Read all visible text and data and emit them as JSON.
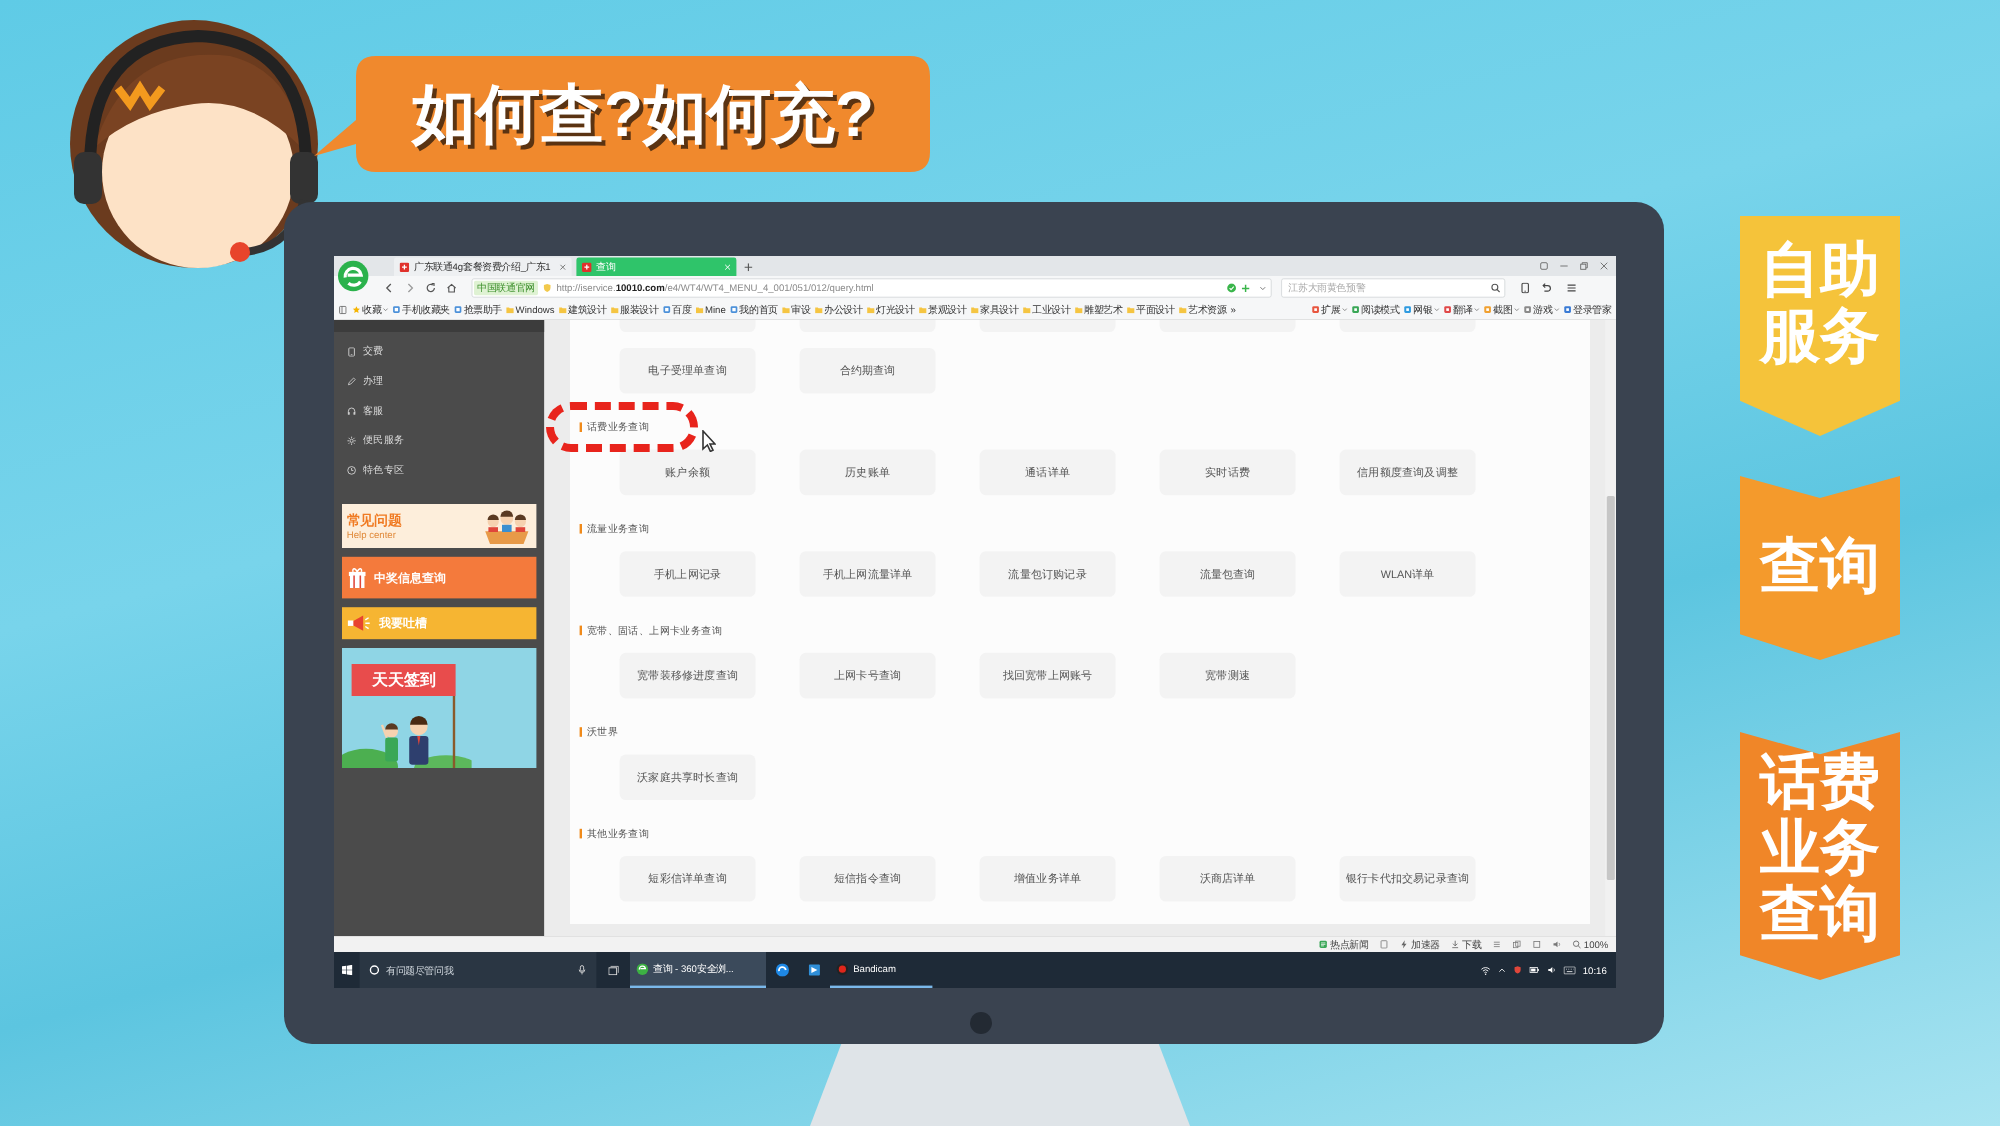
{
  "speech_bubble": {
    "text": "如何查?如何充?"
  },
  "ribbons": [
    {
      "text": "自助服务",
      "color": "#f5c33a"
    },
    {
      "text": "查询",
      "color": "#f49a2c"
    },
    {
      "text": "话费业务查询",
      "color": "#f08628"
    }
  ],
  "browser": {
    "tabs": [
      {
        "title": "广东联通4g套餐资费介绍_广东1",
        "selected": false
      },
      {
        "title": "查询",
        "selected": true
      }
    ],
    "address": {
      "site_badge": "中国联通官网",
      "url": "http://iservice.**10010.com**/e4/WT4/WT4_MENU_4_001/051/012/query.html"
    },
    "search": {
      "placeholder": "江苏大雨黄色预警"
    },
    "bookmarks": [
      {
        "kind": "menu",
        "label": "收藏"
      },
      {
        "kind": "site",
        "label": "手机收藏夹"
      },
      {
        "kind": "site",
        "label": "抢票助手"
      },
      {
        "kind": "folder",
        "label": "Windows"
      },
      {
        "kind": "folder",
        "label": "建筑设计"
      },
      {
        "kind": "folder",
        "label": "服装设计"
      },
      {
        "kind": "site",
        "label": "百度"
      },
      {
        "kind": "folder",
        "label": "Mine"
      },
      {
        "kind": "site",
        "label": "我的首页"
      },
      {
        "kind": "folder",
        "label": "审设"
      },
      {
        "kind": "folder",
        "label": "办公设计"
      },
      {
        "kind": "folder",
        "label": "灯光设计"
      },
      {
        "kind": "folder",
        "label": "景观设计"
      },
      {
        "kind": "folder",
        "label": "家具设计"
      },
      {
        "kind": "folder",
        "label": "工业设计"
      },
      {
        "kind": "folder",
        "label": "雕塑艺术"
      },
      {
        "kind": "folder",
        "label": "平面设计"
      },
      {
        "kind": "folder",
        "label": "艺术资源"
      },
      {
        "kind": "more",
        "label": "»"
      }
    ],
    "extensions": [
      {
        "label": "扩展",
        "dropdown": true
      },
      {
        "label": "阅读模式",
        "dropdown": false
      },
      {
        "label": "网银",
        "dropdown": true
      },
      {
        "label": "翻译",
        "dropdown": true
      },
      {
        "label": "截图",
        "dropdown": true
      },
      {
        "label": "游戏",
        "dropdown": true
      },
      {
        "label": "登录管家",
        "dropdown": false
      }
    ]
  },
  "sidebar": {
    "items": [
      {
        "label": "交费"
      },
      {
        "label": "办理"
      },
      {
        "label": "客服"
      },
      {
        "label": "便民服务"
      },
      {
        "label": "特色专区"
      }
    ],
    "banners": [
      {
        "kind": "help",
        "title": "常见问题",
        "subtitle": "Help center"
      },
      {
        "kind": "prize",
        "title": "中奖信息查询"
      },
      {
        "kind": "feedback",
        "title": "我要吐槽"
      },
      {
        "kind": "checkin",
        "title": "天天签到"
      }
    ]
  },
  "content": {
    "sections": [
      {
        "buttons": [
          "电子受理单查询",
          "合约期查询"
        ]
      },
      {
        "title": "话费业务查询",
        "buttons": [
          "账户余额",
          "历史账单",
          "通话详单",
          "实时话费",
          "信用额度查询及调整"
        ]
      },
      {
        "title": "流量业务查询",
        "buttons": [
          "手机上网记录",
          "手机上网流量详单",
          "流量包订购记录",
          "流量包查询",
          "WLAN详单"
        ]
      },
      {
        "title": "宽带、固话、上网卡业务查询",
        "buttons": [
          "宽带装移修进度查询",
          "上网卡号查询",
          "找回宽带上网账号",
          "宽带测速"
        ]
      },
      {
        "title": "沃世界",
        "buttons": [
          "沃家庭共享时长查询"
        ]
      },
      {
        "title": "其他业务查询",
        "buttons": [
          "短彩信详单查询",
          "短信指令查询",
          "增值业务详单",
          "沃商店详单",
          "银行卡代扣交易记录查询"
        ]
      }
    ]
  },
  "status_bar": {
    "items": [
      {
        "label": "热点新闻"
      },
      {
        "label": "加速器"
      },
      {
        "label": "下载"
      }
    ],
    "zoom": "100%"
  },
  "taskbar": {
    "search": {
      "placeholder": "有问题尽管问我"
    },
    "apps": [
      {
        "label": "查询 - 360安全浏...",
        "selected": true
      },
      {
        "label": "Bandicam",
        "selected": false
      }
    ],
    "time": "10:16"
  }
}
